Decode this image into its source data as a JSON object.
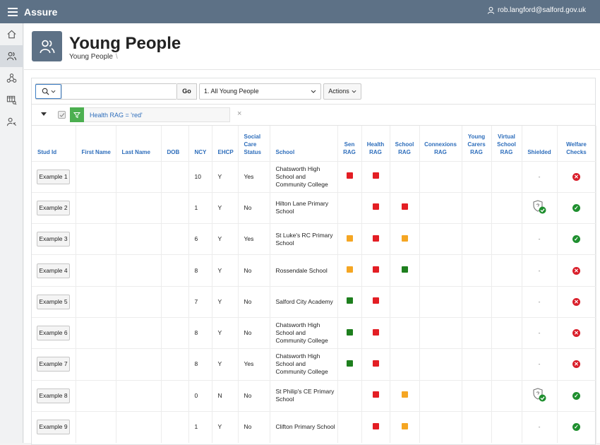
{
  "app": {
    "title": "Assure",
    "user": "rob.langford@salford.gov.uk"
  },
  "nav": [
    "home-icon",
    "people-icon",
    "network-icon",
    "report-icon",
    "user-settings-icon"
  ],
  "page": {
    "title": "Young People",
    "breadcrumb": "Young People"
  },
  "toolbar": {
    "search_value": "",
    "go_label": "Go",
    "report_value": "1. All Young People",
    "actions_label": "Actions"
  },
  "filter": {
    "text": "Health RAG = 'red'",
    "remove": "×"
  },
  "colors": {
    "red": "#e31e24",
    "amber": "#f5a623",
    "green": "#1e7f1e",
    "ok": "#1f8f2f",
    "bad": "#d91e2a",
    "header": "#5d7186"
  },
  "table": {
    "columns": [
      "Stud Id",
      "First Name",
      "Last Name",
      "DOB",
      "NCY",
      "EHCP",
      "Social Care Status",
      "School",
      "Sen RAG",
      "Health RAG",
      "School RAG",
      "Connexions RAG",
      "Young Carers RAG",
      "Virtual School RAG",
      "Shielded",
      "Welfare Checks"
    ],
    "rows": [
      {
        "id": "Example 1",
        "ncy": "10",
        "ehcp": "Y",
        "social": "Yes",
        "school": "Chatsworth High School and Community College",
        "sen": "red",
        "health": "red",
        "schoolrag": "",
        "shielded": "-",
        "welfare": "bad"
      },
      {
        "id": "Example 2",
        "ncy": "1",
        "ehcp": "Y",
        "social": "No",
        "school": "Hilton Lane Primary School",
        "sen": "",
        "health": "red",
        "schoolrag": "red",
        "shielded": "shield",
        "welfare": "ok"
      },
      {
        "id": "Example 3",
        "ncy": "6",
        "ehcp": "Y",
        "social": "Yes",
        "school": "St Luke's RC Primary School",
        "sen": "amber",
        "health": "red",
        "schoolrag": "amber",
        "shielded": "-",
        "welfare": "ok"
      },
      {
        "id": "Example 4",
        "ncy": "8",
        "ehcp": "Y",
        "social": "No",
        "school": "Rossendale School",
        "sen": "amber",
        "health": "red",
        "schoolrag": "green",
        "shielded": "-",
        "welfare": "bad"
      },
      {
        "id": "Example 5",
        "ncy": "7",
        "ehcp": "Y",
        "social": "No",
        "school": "Salford City Academy",
        "sen": "green",
        "health": "red",
        "schoolrag": "",
        "shielded": "-",
        "welfare": "bad"
      },
      {
        "id": "Example 6",
        "ncy": "8",
        "ehcp": "Y",
        "social": "No",
        "school": "Chatsworth High School and Community College",
        "sen": "green",
        "health": "red",
        "schoolrag": "",
        "shielded": "-",
        "welfare": "bad"
      },
      {
        "id": "Example 7",
        "ncy": "8",
        "ehcp": "Y",
        "social": "Yes",
        "school": "Chatsworth High School and Community College",
        "sen": "green",
        "health": "red",
        "schoolrag": "",
        "shielded": "-",
        "welfare": "bad"
      },
      {
        "id": "Example 8",
        "ncy": "0",
        "ehcp": "N",
        "social": "No",
        "school": "St Philip's CE Primary School",
        "sen": "",
        "health": "red",
        "schoolrag": "amber",
        "shielded": "shield",
        "welfare": "ok"
      },
      {
        "id": "Example 9",
        "ncy": "1",
        "ehcp": "Y",
        "social": "No",
        "school": "Clifton Primary School",
        "sen": "",
        "health": "red",
        "schoolrag": "amber",
        "shielded": "-",
        "welfare": "ok"
      }
    ]
  }
}
